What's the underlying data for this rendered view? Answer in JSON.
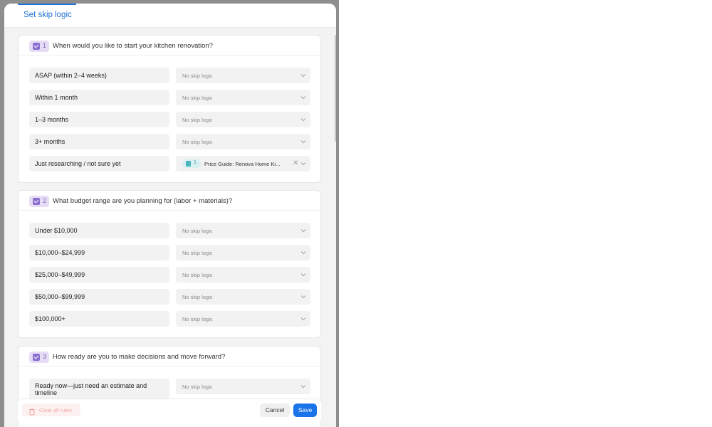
{
  "modal": {
    "tab_label": "Set skip logic"
  },
  "questions": [
    {
      "number": "1",
      "text": "When would you like to start your kitchen renovation?",
      "answers": [
        {
          "label": "ASAP (within 2–4 weeks)",
          "logic": "No skip logic"
        },
        {
          "label": "Within 1 month",
          "logic": "No skip logic"
        },
        {
          "label": "1–3 months",
          "logic": "No skip logic"
        },
        {
          "label": "3+ months",
          "logic": "No skip logic"
        },
        {
          "label": "Just researching / not sure yet",
          "logic_target_number": "1",
          "logic_target": "Price Guide: Renova Home Ki..."
        }
      ]
    },
    {
      "number": "2",
      "text": "What budget range are you planning for (labor + materials)?",
      "answers": [
        {
          "label": "Under $10,000",
          "logic": "No skip logic"
        },
        {
          "label": "$10,000–$24,999",
          "logic": "No skip logic"
        },
        {
          "label": "$25,000–$49,999",
          "logic": "No skip logic"
        },
        {
          "label": "$50,000–$99,999",
          "logic": "No skip logic"
        },
        {
          "label": "$100,000+",
          "logic": "No skip logic"
        }
      ]
    },
    {
      "number": "3",
      "text": "How ready are you to make decisions and move forward?",
      "answers": [
        {
          "label": "Ready now—just need an estimate and timeline",
          "logic": "No skip logic"
        }
      ]
    }
  ],
  "footer": {
    "clear_label": "Clear all rules",
    "cancel_label": "Cancel",
    "save_label": "Save"
  },
  "colors": {
    "accent": "#1a73e8",
    "question_badge": "#e6dcf5",
    "target_badge": "#d9f0f2"
  }
}
